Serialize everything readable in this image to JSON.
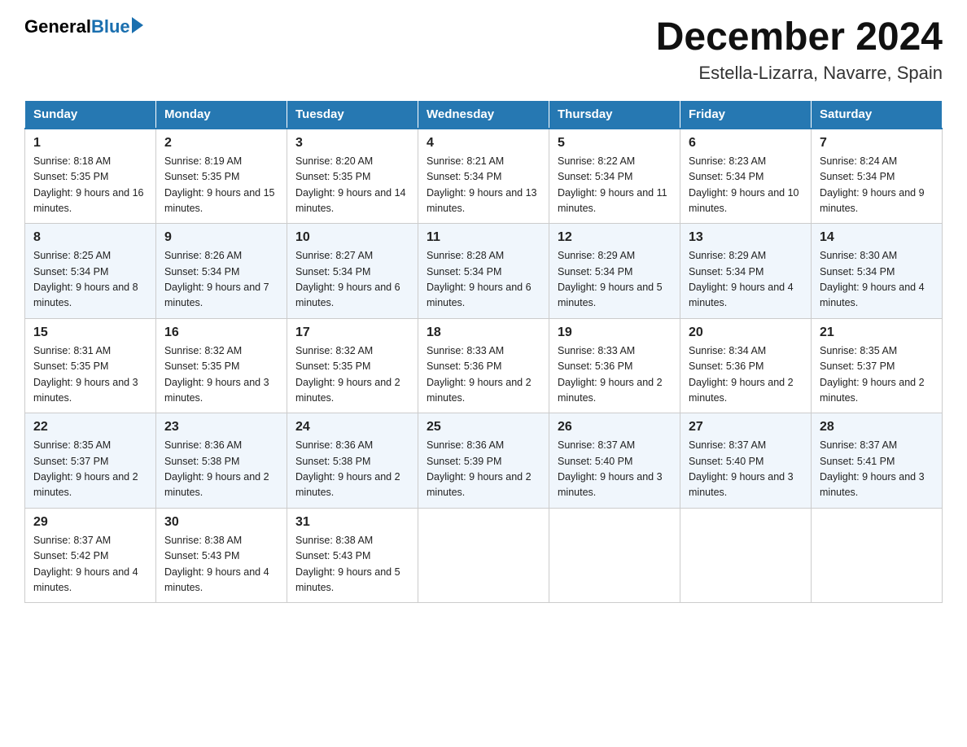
{
  "header": {
    "logo_general": "General",
    "logo_blue": "Blue",
    "month_year": "December 2024",
    "location": "Estella-Lizarra, Navarre, Spain"
  },
  "weekdays": [
    "Sunday",
    "Monday",
    "Tuesday",
    "Wednesday",
    "Thursday",
    "Friday",
    "Saturday"
  ],
  "weeks": [
    [
      {
        "day": "1",
        "sunrise": "8:18 AM",
        "sunset": "5:35 PM",
        "daylight": "9 hours and 16 minutes."
      },
      {
        "day": "2",
        "sunrise": "8:19 AM",
        "sunset": "5:35 PM",
        "daylight": "9 hours and 15 minutes."
      },
      {
        "day": "3",
        "sunrise": "8:20 AM",
        "sunset": "5:35 PM",
        "daylight": "9 hours and 14 minutes."
      },
      {
        "day": "4",
        "sunrise": "8:21 AM",
        "sunset": "5:34 PM",
        "daylight": "9 hours and 13 minutes."
      },
      {
        "day": "5",
        "sunrise": "8:22 AM",
        "sunset": "5:34 PM",
        "daylight": "9 hours and 11 minutes."
      },
      {
        "day": "6",
        "sunrise": "8:23 AM",
        "sunset": "5:34 PM",
        "daylight": "9 hours and 10 minutes."
      },
      {
        "day": "7",
        "sunrise": "8:24 AM",
        "sunset": "5:34 PM",
        "daylight": "9 hours and 9 minutes."
      }
    ],
    [
      {
        "day": "8",
        "sunrise": "8:25 AM",
        "sunset": "5:34 PM",
        "daylight": "9 hours and 8 minutes."
      },
      {
        "day": "9",
        "sunrise": "8:26 AM",
        "sunset": "5:34 PM",
        "daylight": "9 hours and 7 minutes."
      },
      {
        "day": "10",
        "sunrise": "8:27 AM",
        "sunset": "5:34 PM",
        "daylight": "9 hours and 6 minutes."
      },
      {
        "day": "11",
        "sunrise": "8:28 AM",
        "sunset": "5:34 PM",
        "daylight": "9 hours and 6 minutes."
      },
      {
        "day": "12",
        "sunrise": "8:29 AM",
        "sunset": "5:34 PM",
        "daylight": "9 hours and 5 minutes."
      },
      {
        "day": "13",
        "sunrise": "8:29 AM",
        "sunset": "5:34 PM",
        "daylight": "9 hours and 4 minutes."
      },
      {
        "day": "14",
        "sunrise": "8:30 AM",
        "sunset": "5:34 PM",
        "daylight": "9 hours and 4 minutes."
      }
    ],
    [
      {
        "day": "15",
        "sunrise": "8:31 AM",
        "sunset": "5:35 PM",
        "daylight": "9 hours and 3 minutes."
      },
      {
        "day": "16",
        "sunrise": "8:32 AM",
        "sunset": "5:35 PM",
        "daylight": "9 hours and 3 minutes."
      },
      {
        "day": "17",
        "sunrise": "8:32 AM",
        "sunset": "5:35 PM",
        "daylight": "9 hours and 2 minutes."
      },
      {
        "day": "18",
        "sunrise": "8:33 AM",
        "sunset": "5:36 PM",
        "daylight": "9 hours and 2 minutes."
      },
      {
        "day": "19",
        "sunrise": "8:33 AM",
        "sunset": "5:36 PM",
        "daylight": "9 hours and 2 minutes."
      },
      {
        "day": "20",
        "sunrise": "8:34 AM",
        "sunset": "5:36 PM",
        "daylight": "9 hours and 2 minutes."
      },
      {
        "day": "21",
        "sunrise": "8:35 AM",
        "sunset": "5:37 PM",
        "daylight": "9 hours and 2 minutes."
      }
    ],
    [
      {
        "day": "22",
        "sunrise": "8:35 AM",
        "sunset": "5:37 PM",
        "daylight": "9 hours and 2 minutes."
      },
      {
        "day": "23",
        "sunrise": "8:36 AM",
        "sunset": "5:38 PM",
        "daylight": "9 hours and 2 minutes."
      },
      {
        "day": "24",
        "sunrise": "8:36 AM",
        "sunset": "5:38 PM",
        "daylight": "9 hours and 2 minutes."
      },
      {
        "day": "25",
        "sunrise": "8:36 AM",
        "sunset": "5:39 PM",
        "daylight": "9 hours and 2 minutes."
      },
      {
        "day": "26",
        "sunrise": "8:37 AM",
        "sunset": "5:40 PM",
        "daylight": "9 hours and 3 minutes."
      },
      {
        "day": "27",
        "sunrise": "8:37 AM",
        "sunset": "5:40 PM",
        "daylight": "9 hours and 3 minutes."
      },
      {
        "day": "28",
        "sunrise": "8:37 AM",
        "sunset": "5:41 PM",
        "daylight": "9 hours and 3 minutes."
      }
    ],
    [
      {
        "day": "29",
        "sunrise": "8:37 AM",
        "sunset": "5:42 PM",
        "daylight": "9 hours and 4 minutes."
      },
      {
        "day": "30",
        "sunrise": "8:38 AM",
        "sunset": "5:43 PM",
        "daylight": "9 hours and 4 minutes."
      },
      {
        "day": "31",
        "sunrise": "8:38 AM",
        "sunset": "5:43 PM",
        "daylight": "9 hours and 5 minutes."
      },
      null,
      null,
      null,
      null
    ]
  ]
}
